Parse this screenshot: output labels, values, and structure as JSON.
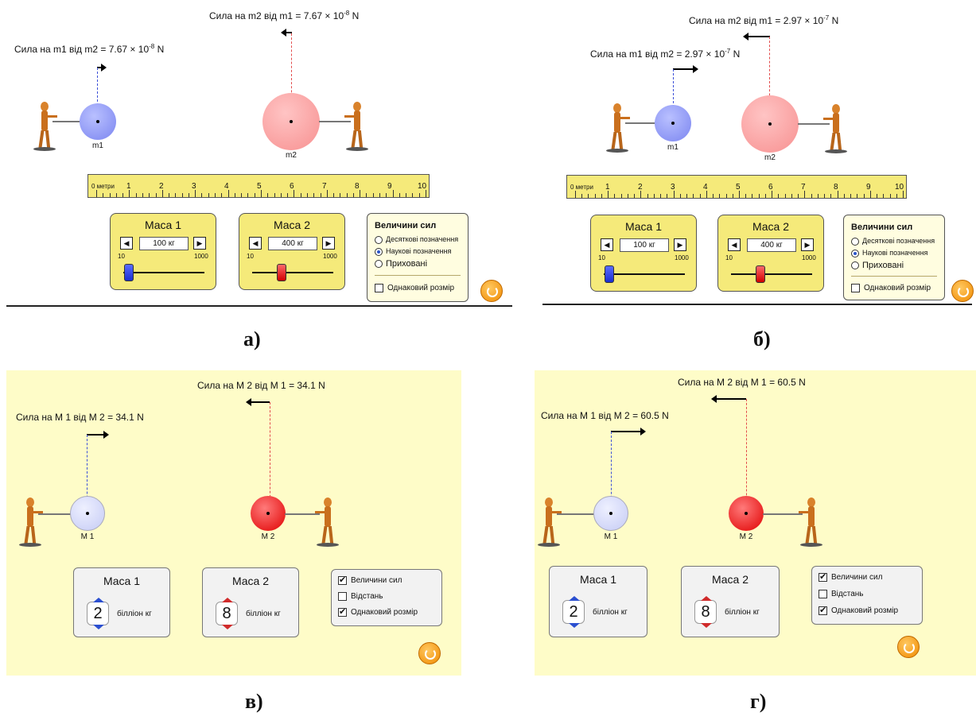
{
  "panels": [
    {
      "force_m2": "Сила на m2 від m1 = 7.67 × 10",
      "force_m2_exp": "-8",
      "force_m1": "Сила на m1 від m2 = 7.67 × 10",
      "force_m1_exp": "-8",
      "force_unit": " N",
      "m1_label": "m1",
      "m2_label": "m2",
      "ruler_unit": "0 метри",
      "ruler_numbers": [
        "1",
        "2",
        "3",
        "4",
        "5",
        "6",
        "7",
        "8",
        "9",
        "10"
      ],
      "mass1_title": "Маса 1",
      "mass1_value": "100 кг",
      "mass2_title": "Маса 2",
      "mass2_value": "400 кг",
      "range_min": "10",
      "range_max": "1000",
      "force_box_title": "Величини сил",
      "opt_decimal": "Десяткові позначення",
      "opt_scientific": "Наукові позначення",
      "opt_hidden": "Приховані",
      "opt_same_size": "Однаковий розмір",
      "caption": "а)"
    },
    {
      "force_m2": "Сила на m2 від m1 = 2.97 × 10",
      "force_m2_exp": "-7",
      "force_m1": "Сила на m1 від m2 = 2.97 × 10",
      "force_m1_exp": "-7",
      "force_unit": " N",
      "m1_label": "m1",
      "m2_label": "m2",
      "ruler_unit": "0 метри",
      "ruler_numbers": [
        "1",
        "2",
        "3",
        "4",
        "5",
        "6",
        "7",
        "8",
        "9",
        "10"
      ],
      "mass1_title": "Маса 1",
      "mass1_value": "100 кг",
      "mass2_title": "Маса 2",
      "mass2_value": "400 кг",
      "range_min": "10",
      "range_max": "1000",
      "force_box_title": "Величини сил",
      "opt_decimal": "Десяткові позначення",
      "opt_scientific": "Наукові позначення",
      "opt_hidden": "Приховані",
      "opt_same_size": "Однаковий розмір",
      "caption": "б)"
    },
    {
      "force_m2": "Сила на M 2 від M 1 = 34.1 N",
      "force_m1": "Сила на M 1 від M 2 = 34.1 N",
      "m1_label": "M 1",
      "m2_label": "M 2",
      "mass1_title": "Маса 1",
      "mass1_value": "2",
      "mass2_title": "Маса 2",
      "mass2_value": "8",
      "mass_unit": "білліон кг",
      "opt_forces": "Величини сил",
      "opt_distance": "Відстань",
      "opt_same_size": "Однаковий розмір",
      "caption": "в)"
    },
    {
      "force_m2": "Сила на M 2 від M 1 = 60.5 N",
      "force_m1": "Сила на M 1 від M 2 = 60.5 N",
      "m1_label": "M 1",
      "m2_label": "M 2",
      "mass1_title": "Маса 1",
      "mass1_value": "2",
      "mass2_title": "Маса 2",
      "mass2_value": "8",
      "mass_unit": "білліон кг",
      "opt_forces": "Величини сил",
      "opt_distance": "Відстань",
      "opt_same_size": "Однаковий розмір",
      "caption": "г)"
    }
  ],
  "colors": {
    "yellow_bg": "#fefcc8",
    "ruler": "#f5ea7a",
    "blue_ball": "#7b85f0",
    "pink_ball": "#f79090",
    "red_ball": "#e00000",
    "reset": "#f08a00"
  }
}
